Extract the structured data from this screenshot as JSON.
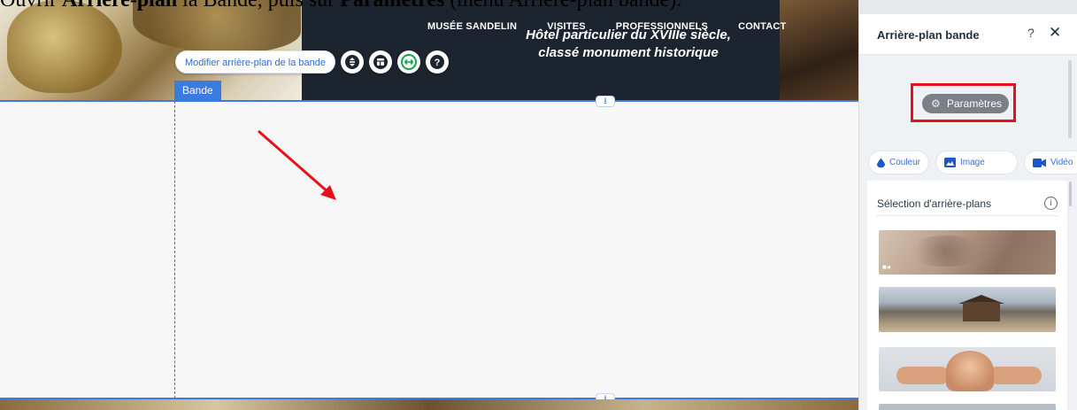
{
  "caption": {
    "prefix": "Ouvrir ",
    "bold1": "Arrière-plan",
    "middle": " la Bande, puis sur ",
    "bold2": "Paramètres",
    "suffix": " (menu Arrière-plan bande)."
  },
  "site": {
    "nav": [
      "MUSÉE SANDELIN",
      "VISITES",
      "PROFESSIONNELS",
      "CONTACT"
    ],
    "hero_title_line1": "Hôtel particulier du XVIIIe siècle,",
    "hero_title_line2": "classé monument historique"
  },
  "editor": {
    "toolbar_label": "Modifier arrière-plan de la bande",
    "toolbar_icons": [
      "layers-icon",
      "layout-icon",
      "stretch-icon",
      "help-icon"
    ],
    "band_tag": "Bande",
    "arrow_color": "#e6121b",
    "selection_color": "#3b7be0"
  },
  "panel": {
    "title": "Arrière-plan bande",
    "help": "?",
    "close": "✕",
    "settings_button": "Paramètres",
    "types": [
      {
        "label": "Couleur",
        "icon": "drop-icon"
      },
      {
        "label": "Image",
        "icon": "image-icon"
      },
      {
        "label": "Vidéo",
        "icon": "video-icon"
      }
    ],
    "selection_label": "Sélection d'arrière-plans",
    "info": "i"
  }
}
